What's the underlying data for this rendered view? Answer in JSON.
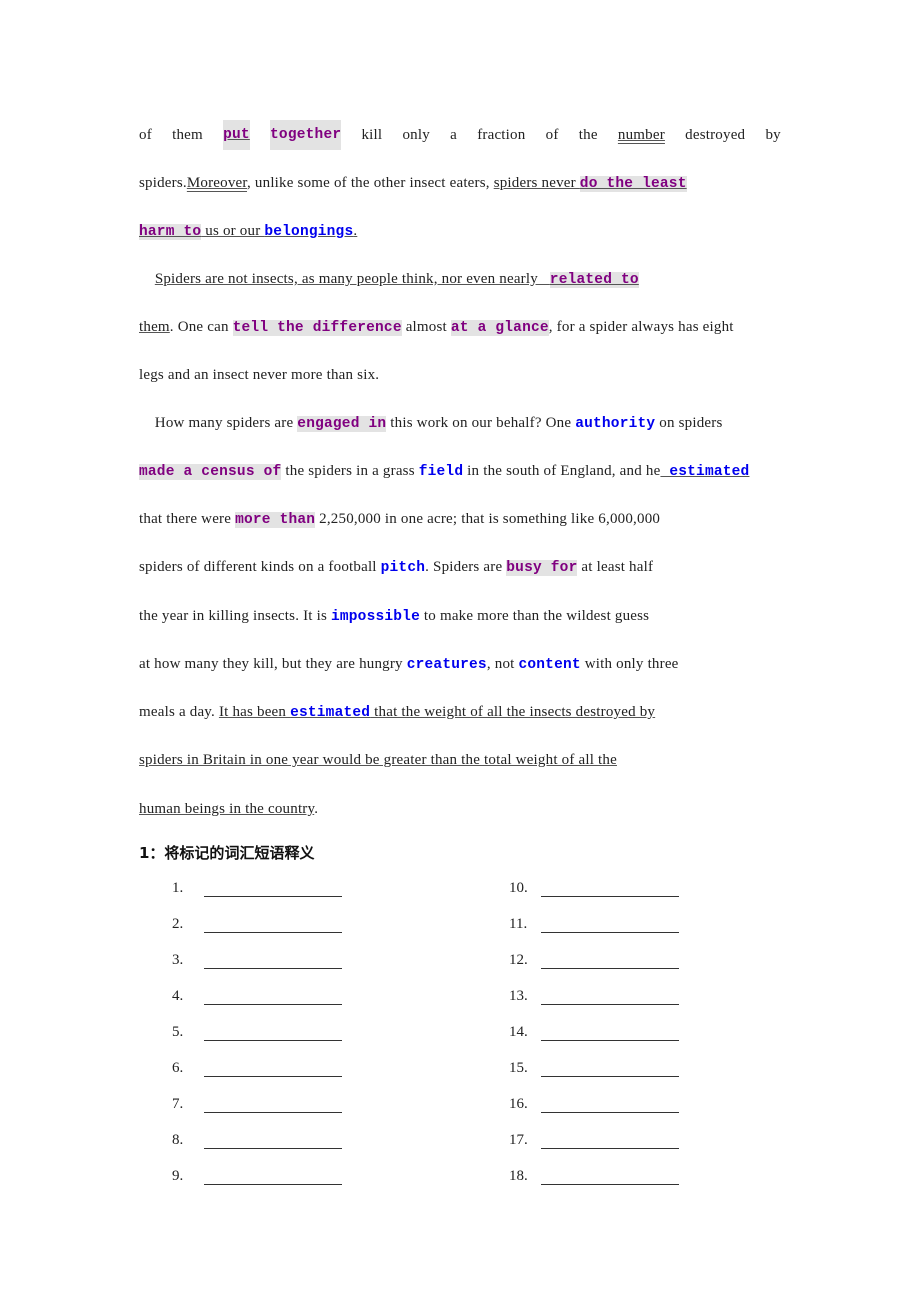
{
  "passage": {
    "lines": [
      [
        {
          "t": "of"
        },
        {
          "t": "them"
        },
        {
          "t": "put",
          "style": "ph u1"
        },
        {
          "t": "together",
          "style": "ph"
        },
        {
          "t": "kill"
        },
        {
          "t": "only"
        },
        {
          "t": "a"
        },
        {
          "t": "fraction"
        },
        {
          "t": "of"
        },
        {
          "t": "the"
        },
        {
          "t": "number",
          "style": "u2"
        },
        {
          "t": "destroyed"
        },
        {
          "t": "by"
        }
      ],
      [
        {
          "t": "spiders."
        },
        {
          "t": "Moreover",
          "style": "u2"
        },
        {
          "t": ", unlike some of the other insect eaters, "
        },
        {
          "t": "spiders never ",
          "style": "u1"
        },
        {
          "t": "do the least",
          "style": "ph u1"
        }
      ],
      [
        {
          "t": "harm to",
          "style": "ph u1"
        },
        {
          "t": " us or our ",
          "style": "u1"
        },
        {
          "t": "belongings",
          "style": "vb u1"
        },
        {
          "t": ".",
          "style": "u1"
        }
      ],
      [
        {
          "t": "    "
        },
        {
          "t": "Spiders are not insects, as many people think, nor even nearly   ",
          "style": "u1"
        },
        {
          "t": "related to",
          "style": "ph u1"
        }
      ],
      [
        {
          "t": "them",
          "style": "u1"
        },
        {
          "t": ". One can "
        },
        {
          "t": "tell the difference",
          "style": "ph"
        },
        {
          "t": " almost "
        },
        {
          "t": "at a glance",
          "style": "ph"
        },
        {
          "t": ", for a spider always has eight"
        }
      ],
      [
        {
          "t": "legs and an insect never more than six."
        }
      ],
      [
        {
          "t": "    How many spiders are "
        },
        {
          "t": "engaged in",
          "style": "ph"
        },
        {
          "t": " this work on our behalf? One "
        },
        {
          "t": "authority",
          "style": "vb"
        },
        {
          "t": " on spiders"
        }
      ],
      [
        {
          "t": "made a census of",
          "style": "ph"
        },
        {
          "t": " the spiders in a grass "
        },
        {
          "t": "field",
          "style": "vb"
        },
        {
          "t": " in the south of England, and he"
        },
        {
          "t": " estimated",
          "style": "vb u1"
        }
      ],
      [
        {
          "t": "that there were "
        },
        {
          "t": "more than",
          "style": "ph"
        },
        {
          "t": " 2,250,000 in one acre; that is something like 6,000,000"
        }
      ],
      [
        {
          "t": "spiders of different kinds on a football "
        },
        {
          "t": "pitch",
          "style": "vb"
        },
        {
          "t": ". Spiders are "
        },
        {
          "t": "busy for",
          "style": "ph"
        },
        {
          "t": " at least half"
        }
      ],
      [
        {
          "t": "the year in killing insects. It is "
        },
        {
          "t": "impossible",
          "style": "vb"
        },
        {
          "t": " to make more than the wildest guess"
        }
      ],
      [
        {
          "t": "at how many they kill, but they are hungry "
        },
        {
          "t": "creatures",
          "style": "vb"
        },
        {
          "t": ", not "
        },
        {
          "t": "content",
          "style": "vb"
        },
        {
          "t": " with only three"
        }
      ],
      [
        {
          "t": "meals a day. "
        },
        {
          "t": "It has been ",
          "style": "u1"
        },
        {
          "t": "estimated",
          "style": "vb u1"
        },
        {
          "t": " that the weight of all the insects destroyed by",
          "style": "u1"
        }
      ],
      [
        {
          "t": "spiders in Britain in one year would be greater than the total weight of all the",
          "style": "u1"
        }
      ],
      [
        {
          "t": "human beings in the country",
          "style": "u1"
        },
        {
          "t": "."
        }
      ]
    ]
  },
  "exercise": {
    "heading": "1：将标记的词汇短语释义",
    "left_numbers": [
      "1.",
      "2.",
      "3.",
      "4.",
      "5.",
      "6.",
      "7.",
      "8.",
      "9."
    ],
    "right_numbers": [
      "10.",
      "11.",
      "12.",
      "13.",
      "14.",
      "15.",
      "16.",
      "17.",
      "18."
    ]
  },
  "colors": {
    "phrase": "#800080",
    "phrase_highlight": "#e3e3e3",
    "vocab": "#0000ee",
    "text": "#222222"
  }
}
